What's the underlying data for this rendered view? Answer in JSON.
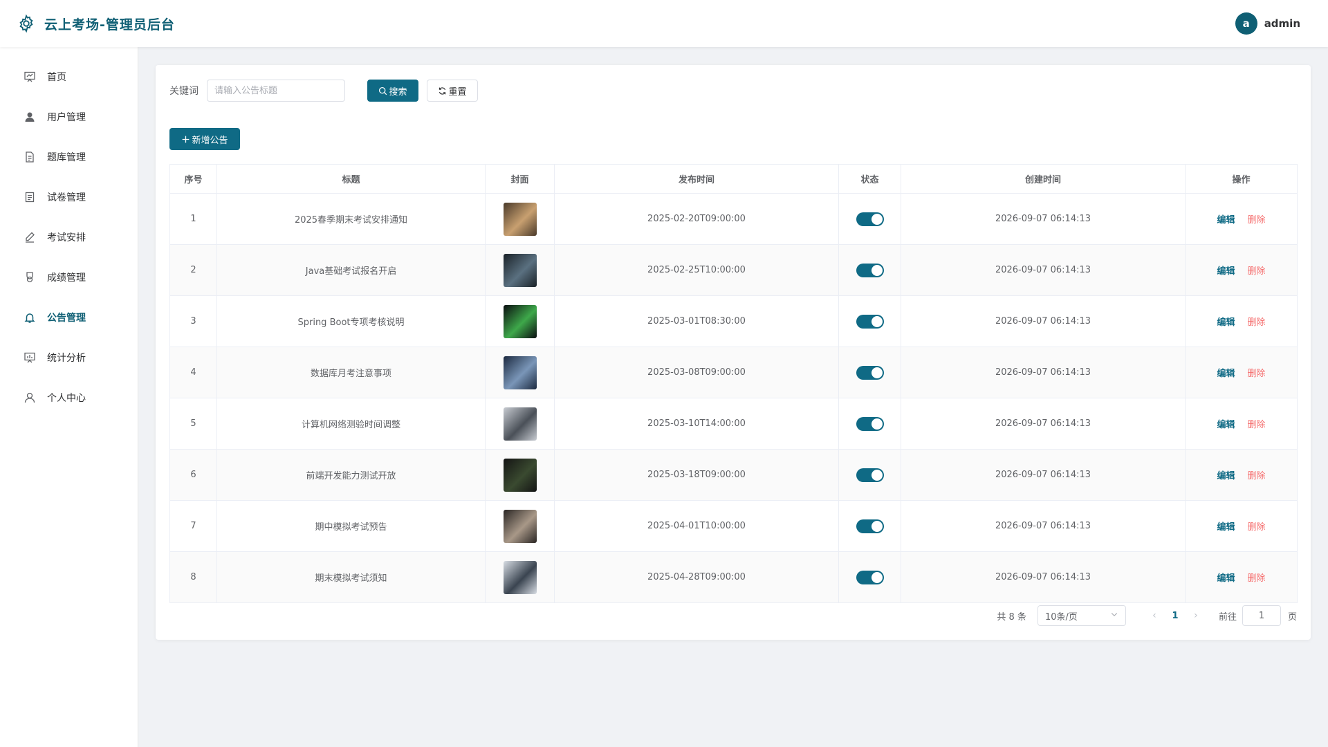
{
  "app": {
    "title": "云上考场-管理员后台"
  },
  "user": {
    "avatar_letter": "a",
    "name": "admin"
  },
  "sidebar": {
    "items": [
      {
        "label": "首页",
        "icon": "dashboard-icon",
        "active": false
      },
      {
        "label": "用户管理",
        "icon": "user-icon",
        "active": false
      },
      {
        "label": "题库管理",
        "icon": "document-icon",
        "active": false
      },
      {
        "label": "试卷管理",
        "icon": "tickets-icon",
        "active": false
      },
      {
        "label": "考试安排",
        "icon": "edit-pen-icon",
        "active": false
      },
      {
        "label": "成绩管理",
        "icon": "medal-icon",
        "active": false
      },
      {
        "label": "公告管理",
        "icon": "bell-icon",
        "active": true
      },
      {
        "label": "统计分析",
        "icon": "chart-icon",
        "active": false
      },
      {
        "label": "个人中心",
        "icon": "person-icon",
        "active": false
      }
    ]
  },
  "search": {
    "label": "关键词",
    "placeholder": "请输入公告标题",
    "value": "",
    "search_label": "搜索",
    "reset_label": "重置"
  },
  "toolbar": {
    "add_label": "新增公告"
  },
  "table": {
    "columns": [
      "序号",
      "标题",
      "封面",
      "发布时间",
      "状态",
      "创建时间",
      "操作"
    ],
    "rows": [
      {
        "index": "1",
        "title": "2025春季期末考试安排通知",
        "publish_time": "2025-02-20T09:00:00",
        "status": true,
        "created": "2026-09-07 06:14:13",
        "cover": [
          "#4a3a2a",
          "#c8a070"
        ]
      },
      {
        "index": "2",
        "title": "Java基础考试报名开启",
        "publish_time": "2025-02-25T10:00:00",
        "status": true,
        "created": "2026-09-07 06:14:13",
        "cover": [
          "#1a2228",
          "#5a7080"
        ]
      },
      {
        "index": "3",
        "title": "Spring Boot专项考核说明",
        "publish_time": "2025-03-01T08:30:00",
        "status": true,
        "created": "2026-09-07 06:14:13",
        "cover": [
          "#0a0d10",
          "#3ea84a"
        ]
      },
      {
        "index": "4",
        "title": "数据库月考注意事项",
        "publish_time": "2025-03-08T09:00:00",
        "status": true,
        "created": "2026-09-07 06:14:13",
        "cover": [
          "#1c2a40",
          "#7a96b8"
        ]
      },
      {
        "index": "5",
        "title": "计算机网络测验时间调整",
        "publish_time": "2025-03-10T14:00:00",
        "status": true,
        "created": "2026-09-07 06:14:13",
        "cover": [
          "#c8ccd2",
          "#4a5058"
        ]
      },
      {
        "index": "6",
        "title": "前端开发能力测试开放",
        "publish_time": "2025-03-18T09:00:00",
        "status": true,
        "created": "2026-09-07 06:14:13",
        "cover": [
          "#141414",
          "#3a4a30"
        ]
      },
      {
        "index": "7",
        "title": "期中模拟考试预告",
        "publish_time": "2025-04-01T10:00:00",
        "status": true,
        "created": "2026-09-07 06:14:13",
        "cover": [
          "#2a2624",
          "#a89888"
        ]
      },
      {
        "index": "8",
        "title": "期末模拟考试须知",
        "publish_time": "2025-04-28T09:00:00",
        "status": true,
        "created": "2026-09-07 06:14:13",
        "cover": [
          "#d8dde4",
          "#3a4450"
        ]
      }
    ],
    "edit_label": "编辑",
    "delete_label": "删除"
  },
  "pagination": {
    "total_text": "共 8 条",
    "page_size": "10条/页",
    "current_page": "1",
    "goto_label": "前往",
    "goto_value": "1",
    "page_unit": "页"
  },
  "colors": {
    "primary": "#0f6a85",
    "danger": "#f56c6c",
    "brand": "#0f5f74"
  }
}
